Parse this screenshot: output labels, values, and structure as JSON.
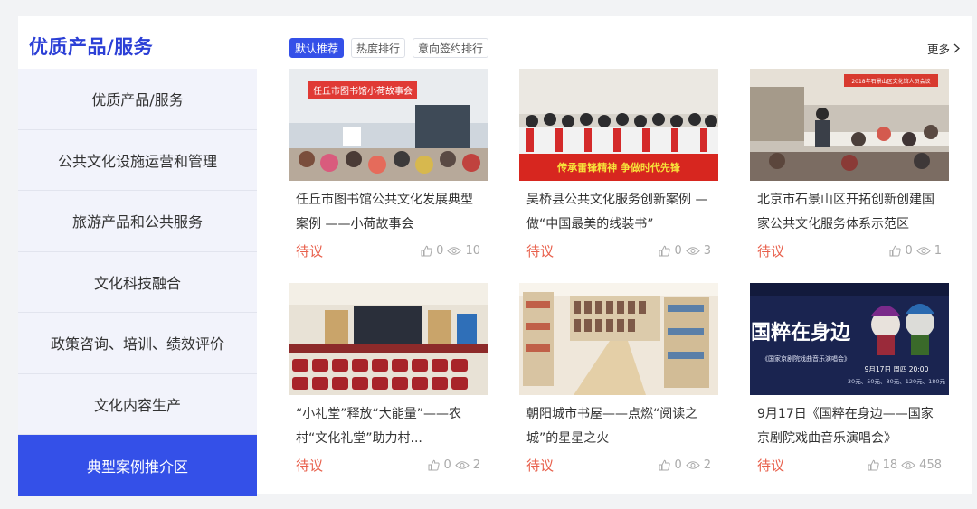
{
  "sidebar": {
    "title": "优质产品/服务",
    "items": [
      {
        "label": "优质产品/服务",
        "active": false
      },
      {
        "label": "公共文化设施运营和管理",
        "active": false
      },
      {
        "label": "旅游产品和公共服务",
        "active": false
      },
      {
        "label": "文化科技融合",
        "active": false
      },
      {
        "label": "政策咨询、培训、绩效评价",
        "active": false
      },
      {
        "label": "文化内容生产",
        "active": false
      },
      {
        "label": "典型案例推介区",
        "active": true
      }
    ]
  },
  "tabs": [
    {
      "label": "默认推荐",
      "active": true
    },
    {
      "label": "热度排行",
      "active": false
    },
    {
      "label": "意向签约排行",
      "active": false
    }
  ],
  "more_label": "更多",
  "cards": [
    {
      "title": "任丘市图书馆公共文化发展典型案例 ——小荷故事会",
      "status": "待议",
      "likes": "0",
      "views": "10",
      "image": "library-children-storytelling-photo",
      "banner": "任丘市图书馆小荷故事会"
    },
    {
      "title": "吴桥县公共文化服务创新案例 —做“中国最美的线装书”",
      "status": "待议",
      "likes": "0",
      "views": "3",
      "image": "group-photo-red-banner",
      "banner": "传承雷锋精神  争做时代先锋"
    },
    {
      "title": "北京市石景山区开拓创新创建国家公共文化服务体系示范区",
      "status": "待议",
      "likes": "0",
      "views": "1",
      "image": "meeting-room-photo",
      "banner": "2018年石景山区文化馆人员会议"
    },
    {
      "title": "“小礼堂”释放“大能量”——农村“文化礼堂”助力村...",
      "status": "待议",
      "likes": "0",
      "views": "2",
      "image": "auditorium-red-seats-photo"
    },
    {
      "title": "朝阳城市书屋——点燃“阅读之城”的星星之火",
      "status": "待议",
      "likes": "0",
      "views": "2",
      "image": "bookstore-shelves-photo"
    },
    {
      "title": "9月17日《国粹在身边——国家京剧院戏曲音乐演唱会》",
      "status": "待议",
      "likes": "18",
      "views": "458",
      "image": "peking-opera-poster",
      "poster_title": "国粹在身边",
      "poster_sub": "《国家京剧院戏曲音乐演唱会》",
      "poster_date": "9月17日 周四 20:00",
      "poster_prices": "30元、50元、80元、120元、180元"
    }
  ],
  "colors": {
    "accent": "#3450e8",
    "status": "#e8604c",
    "title": "#2b3fd6"
  }
}
